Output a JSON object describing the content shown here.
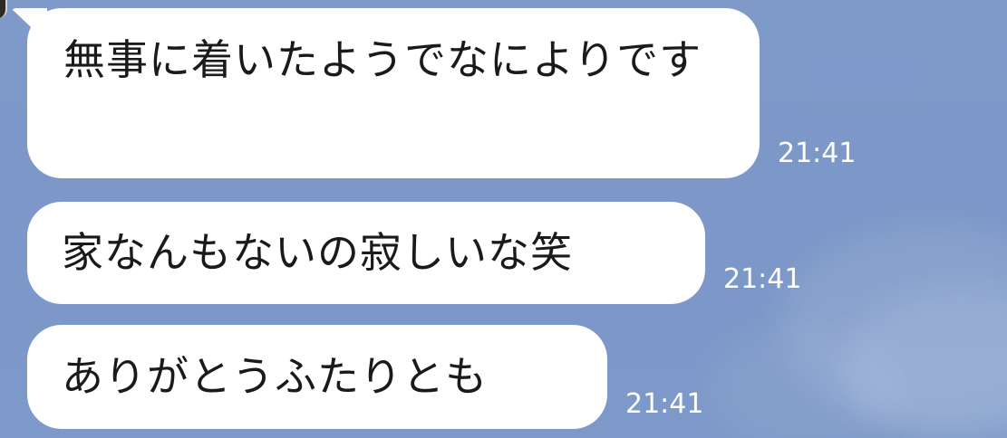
{
  "chat": {
    "messages": [
      {
        "text": "無事に着いたようでなによりです",
        "time": "21:41"
      },
      {
        "text": "家なんもないの寂しいな笑",
        "time": "21:41"
      },
      {
        "text": "ありがとうふたりとも",
        "time": "21:41"
      }
    ]
  },
  "colors": {
    "background": "#7f9ac9",
    "bubble": "#ffffff",
    "text": "#1a1a1a",
    "timestamp": "#ffffff"
  },
  "icons": {
    "avatar": "avatar-icon"
  }
}
